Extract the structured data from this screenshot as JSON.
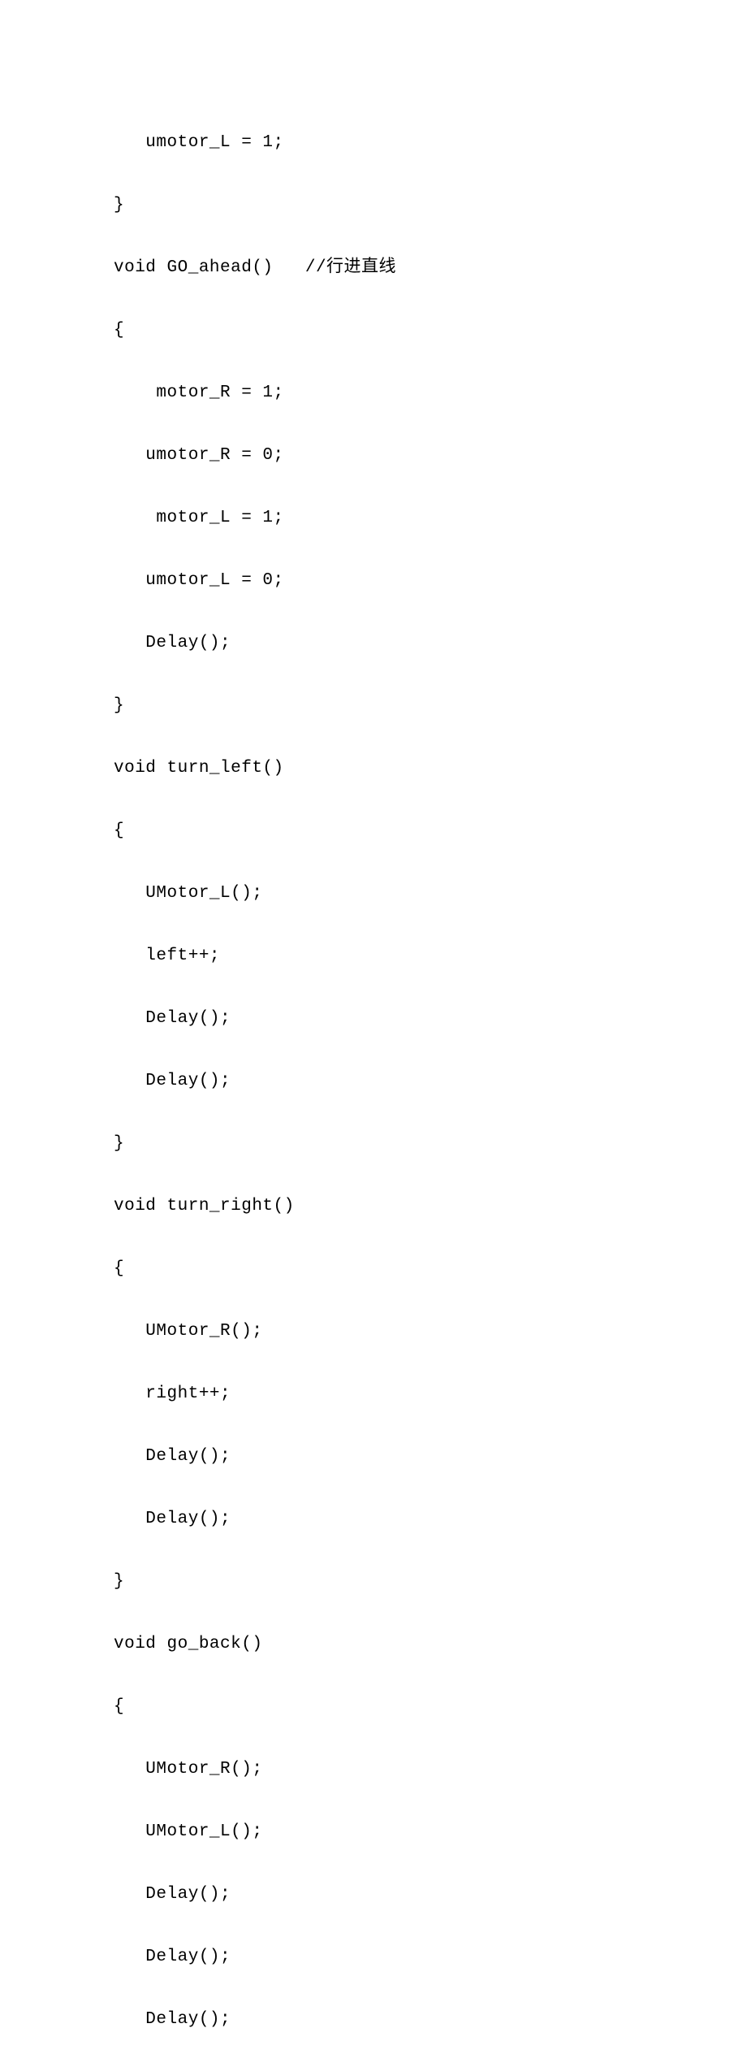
{
  "code_lines": [
    "   umotor_L = 1;",
    "}",
    "void GO_ahead()   //行进直线",
    "{",
    "    motor_R = 1;",
    "   umotor_R = 0;",
    "    motor_L = 1;",
    "   umotor_L = 0;",
    "   Delay();",
    "}",
    "void turn_left()",
    "{",
    "   UMotor_L();",
    "   left++;",
    "   Delay();",
    "   Delay();",
    "}",
    "void turn_right()",
    "{",
    "   UMotor_R();",
    "   right++;",
    "   Delay();",
    "   Delay();",
    "}",
    "void go_back()",
    "{",
    "   UMotor_R();",
    "   UMotor_L();",
    "   Delay();",
    "   Delay();",
    "   Delay();"
  ]
}
